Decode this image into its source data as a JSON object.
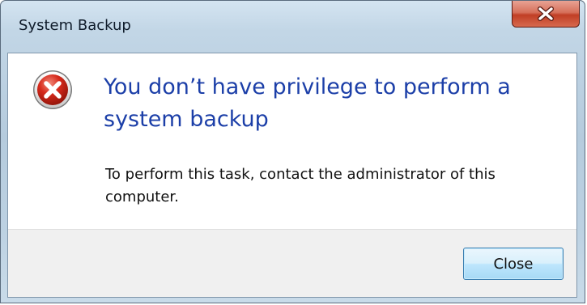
{
  "window": {
    "title": "System Backup"
  },
  "titlebar": {
    "close_icon": "close-x-icon"
  },
  "dialog": {
    "icon": "error-icon",
    "main_instruction": "You don’t have privilege to perform a system backup",
    "content_text": "To perform this task, contact the administrator of this computer."
  },
  "footer": {
    "close_label": "Close"
  },
  "colors": {
    "main_instruction": "#1c3fa8",
    "error_red": "#d62a1c",
    "close_x_red": "#c03e25"
  }
}
